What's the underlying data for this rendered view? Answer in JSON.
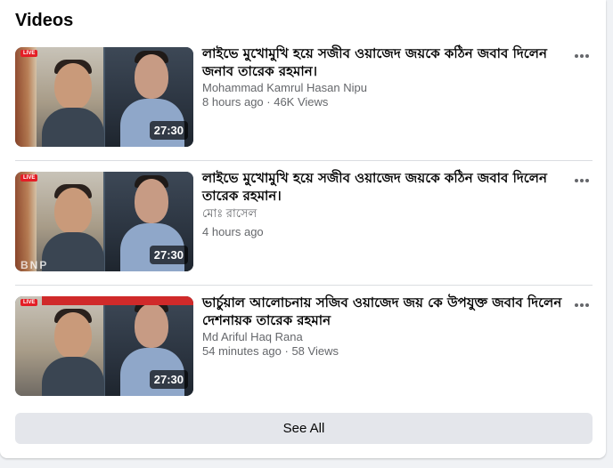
{
  "section": {
    "title": "Videos"
  },
  "videos": [
    {
      "title": "লাইভে মুখোমুখি হয়ে সজীব ওয়াজেদ জয়কে কঠিন জবাব দিলেন জনাব তারেক রহমান।",
      "author": "Mohammad Kamrul Hasan Nipu",
      "meta": "8 hours ago · 46K Views",
      "duration": "27:30",
      "badge": "LIVE"
    },
    {
      "title": "লাইভে মুখোমুখি হয়ে সজীব ওয়াজেদ জয়কে কঠিন জবাব দিলেন তারেক রহমান।",
      "author": "মোঃ রাসেল",
      "meta": "4 hours ago",
      "duration": "27:30",
      "badge": "LIVE",
      "watermark": "BNP"
    },
    {
      "title": "ভার্চুয়াল আলোচনায় সজিব ওয়াজেদ জয় কে উপযুক্ত জবাব দিলেন দেশনায়ক তারেক রহমান",
      "author": "Md Ariful Haq Rana",
      "meta": "54 minutes ago · 58 Views",
      "duration": "27:30",
      "badge": "LIVE"
    }
  ],
  "see_all_label": "See All",
  "colors": {
    "card_bg": "#ffffff",
    "page_bg": "#f0f2f5",
    "secondary_text": "#65676b",
    "button_bg": "#e4e6eb",
    "live_red": "#e41e26"
  }
}
